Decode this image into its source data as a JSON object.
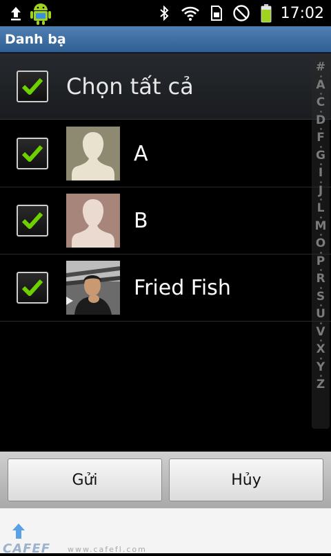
{
  "status_bar": {
    "time": "17:02",
    "icons": [
      "upload-icon",
      "android-icon",
      "bluetooth-icon",
      "wifi-icon",
      "sim-icon",
      "no-sign-icon",
      "battery-icon"
    ]
  },
  "title_bar": {
    "title": "Danh bạ"
  },
  "select_all": {
    "label": "Chọn tất cả",
    "checked": true
  },
  "contacts": [
    {
      "name": "A",
      "checked": true,
      "avatar": "default-avatar-icon",
      "avatar_bg": "#8e8a72"
    },
    {
      "name": "B",
      "checked": true,
      "avatar": "default-avatar-icon",
      "avatar_bg": "#a8857b"
    },
    {
      "name": "Fried Fish",
      "checked": true,
      "avatar": "photo-avatar",
      "avatar_bg": "#5a5a5a"
    }
  ],
  "index_letters": [
    "#",
    "A",
    "C",
    "D",
    "F",
    "G",
    "I",
    "J",
    "L",
    "M",
    "O",
    "P",
    "R",
    "S",
    "U",
    "V",
    "X",
    "Y",
    "Z"
  ],
  "buttons": {
    "send": "Gửi",
    "cancel": "Hủy"
  },
  "footer": {
    "watermark": "CAFEF",
    "watermark_url": "www.cafefl.com"
  },
  "colors": {
    "check_green": "#6fd000",
    "title_blue": "#3f6fa3"
  }
}
